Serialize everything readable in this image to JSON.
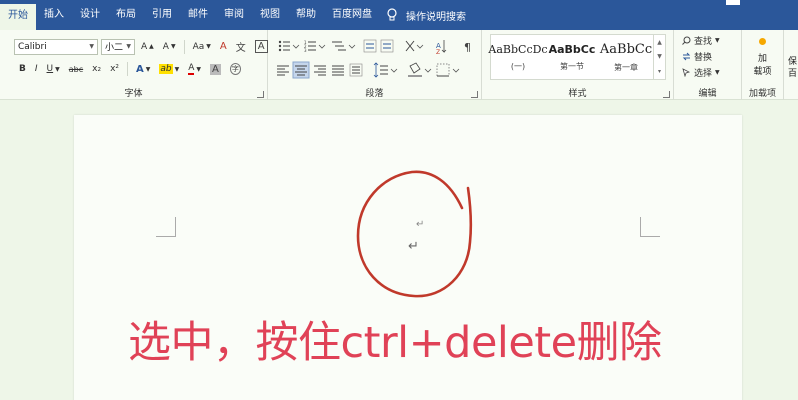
{
  "menu": {
    "tabs": [
      "开始",
      "插入",
      "设计",
      "布局",
      "引用",
      "邮件",
      "审阅",
      "视图",
      "帮助",
      "百度网盘"
    ],
    "active_tab": "开始",
    "tell_me": "操作说明搜索"
  },
  "ribbon": {
    "font": {
      "label": "字体",
      "font_name": "Calibri",
      "font_size": "小二",
      "grow": "A",
      "shrink": "A",
      "change_case": "Aa",
      "clear_format": "A",
      "phonetic": "文",
      "border_char": "A",
      "bold": "B",
      "italic": "I",
      "underline": "U",
      "strike": "abc",
      "subscript": "x₂",
      "superscript": "x²",
      "text_effect": "A",
      "highlight": "ab",
      "font_color": "A",
      "char_shade": "A",
      "enclose": "字"
    },
    "paragraph": {
      "label": "段落"
    },
    "styles": {
      "label": "样式",
      "items": [
        {
          "sample": "AaBbCcDc",
          "name": "(一)"
        },
        {
          "sample": "AaBbCc",
          "name": "第一节"
        },
        {
          "sample": "AaBbCc",
          "name": "第一章"
        }
      ]
    },
    "editing": {
      "label": "编辑",
      "find": "查找",
      "replace": "替换",
      "select": "选择"
    },
    "addins": {
      "label": "加载项",
      "button_line1": "加",
      "button_line2": "载项",
      "edge_text_1": "保",
      "edge_text_2": "百"
    }
  },
  "document": {
    "paragraph_mark": "↵",
    "caption": "选中，按住ctrl+delete删除"
  },
  "colors": {
    "title_bar": "#2b579a",
    "caption": "#e04257",
    "circle": "#c0392b"
  }
}
